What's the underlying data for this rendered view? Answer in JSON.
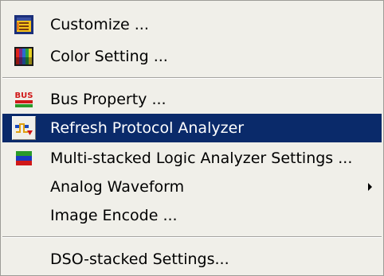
{
  "menu": {
    "items": [
      {
        "label": "Customize ...",
        "icon": "customize-icon"
      },
      {
        "label": "Color Setting ...",
        "icon": "color-setting-icon"
      },
      {
        "label": "Bus Property ...",
        "icon": "bus-property-icon",
        "icon_text": "BUS"
      },
      {
        "label": "Refresh Protocol Analyzer",
        "icon": "protocol-analyzer-icon",
        "selected": true
      },
      {
        "label": "Multi-stacked Logic Analyzer Settings ...",
        "icon": "logic-analyzer-icon"
      },
      {
        "label": "Analog Waveform",
        "submenu": true,
        "submenu_icon": "submenu-arrow-icon"
      },
      {
        "label": "Image Encode ..."
      },
      {
        "label": "DSO-stacked Settings..."
      }
    ]
  },
  "colors": {
    "menu_background": "#f0efe9",
    "selection_background": "#0a2a6a",
    "selection_text": "#ffffff",
    "text": "#000000"
  }
}
